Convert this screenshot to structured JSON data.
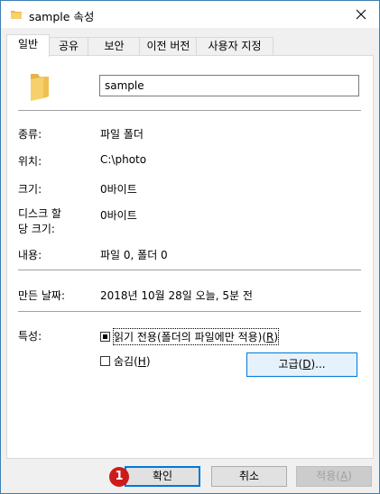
{
  "window": {
    "title": "sample 속성",
    "close_icon": "close-icon"
  },
  "tabs": [
    {
      "label": "일반",
      "active": true
    },
    {
      "label": "공유",
      "active": false
    },
    {
      "label": "보안",
      "active": false
    },
    {
      "label": "이전 버전",
      "active": false
    },
    {
      "label": "사용자 지정",
      "active": false
    }
  ],
  "general": {
    "folder_name": "sample",
    "rows": [
      {
        "label": "종류:",
        "value": "파일 폴더"
      },
      {
        "label": "위치:",
        "value": "C:\\photo"
      },
      {
        "label": "크기:",
        "value": "0바이트"
      },
      {
        "label": "디스크 할\n당 크기:",
        "value": "0바이트"
      },
      {
        "label": "내용:",
        "value": "파일 0, 폴더 0"
      }
    ],
    "created_label": "만든 날짜:",
    "created_value": "2018년 10월 28일 오늘, 5분 전",
    "attributes_label": "특성:",
    "readonly_text": "읽기 전용(폴더의 파일에만 적용)",
    "readonly_key": "R",
    "readonly_state": "indeterminate",
    "hidden_text": "숨김",
    "hidden_key": "H",
    "hidden_state": "unchecked",
    "advanced_text": "고급",
    "advanced_key": "D",
    "advanced_suffix": "..."
  },
  "footer": {
    "ok_label": "확인",
    "cancel_label": "취소",
    "apply_text": "적용",
    "apply_key": "A",
    "badge": "1"
  },
  "colors": {
    "accent": "#0078d7",
    "badge": "#cc1b1b",
    "folder": "#f5cb5c"
  }
}
